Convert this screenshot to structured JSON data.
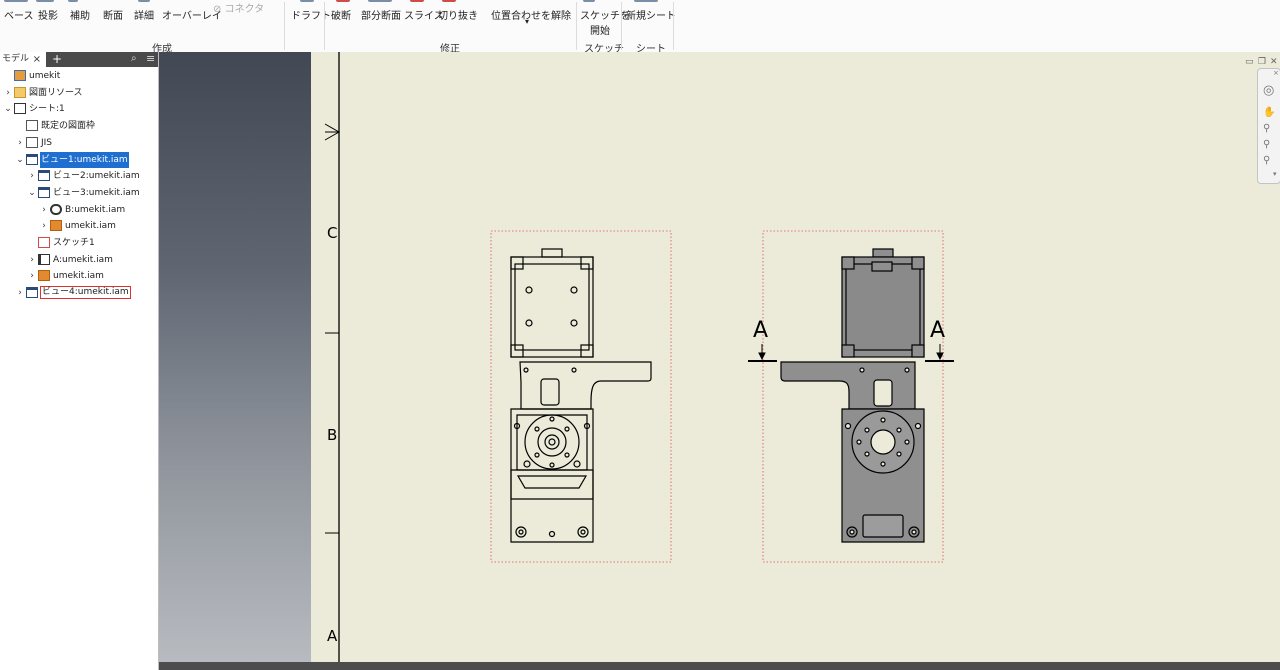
{
  "ribbon": {
    "create_group": {
      "label": "作成",
      "buttons": [
        "ベース",
        "投影",
        "補助",
        "断面",
        "詳細",
        "オーバーレイ"
      ],
      "connector": "コネクタ"
    },
    "draft": "ドラフト",
    "modify_group": {
      "label": "修正",
      "buttons": [
        "破断",
        "部分断面",
        "スライス",
        "切り抜き"
      ],
      "unalign": "位置合わせを解除"
    },
    "sketch_group": {
      "label": "スケッチ",
      "start_line1": "スケッチを",
      "start_line2": "開始"
    },
    "sheet_group": {
      "label": "シート",
      "new_sheet": "新規シート"
    }
  },
  "browser": {
    "tab_label": "モデル",
    "close": "×",
    "add": "+",
    "tree": [
      {
        "label": "umekit",
        "indent": 0,
        "chevron": "",
        "icon": "assembly-icon",
        "state": ""
      },
      {
        "label": "図面リソース",
        "indent": 0,
        "chevron": "›",
        "icon": "folder-icon",
        "state": ""
      },
      {
        "label": "シート:1",
        "indent": 0,
        "chevron": "⌄",
        "icon": "sheet-icon",
        "state": ""
      },
      {
        "label": "既定の図面枠",
        "indent": 1,
        "chevron": "",
        "icon": "border-icon",
        "state": ""
      },
      {
        "label": "JIS",
        "indent": 1,
        "chevron": "›",
        "icon": "titleblock-icon",
        "state": ""
      },
      {
        "label": "ビュー1:umekit.iam",
        "indent": 1,
        "chevron": "⌄",
        "icon": "view-icon",
        "state": "selected"
      },
      {
        "label": "ビュー2:umekit.iam",
        "indent": 2,
        "chevron": "›",
        "icon": "view-icon",
        "state": ""
      },
      {
        "label": "ビュー3:umekit.iam",
        "indent": 2,
        "chevron": "⌄",
        "icon": "view-icon",
        "state": ""
      },
      {
        "label": "B:umekit.iam",
        "indent": 3,
        "chevron": "›",
        "icon": "detail-icon",
        "state": ""
      },
      {
        "label": "umekit.iam",
        "indent": 3,
        "chevron": "›",
        "icon": "part-icon",
        "state": ""
      },
      {
        "label": "スケッチ1",
        "indent": 2,
        "chevron": "",
        "icon": "sketch-icon",
        "state": ""
      },
      {
        "label": "A:umekit.iam",
        "indent": 2,
        "chevron": "›",
        "icon": "section-icon",
        "state": ""
      },
      {
        "label": "umekit.iam",
        "indent": 2,
        "chevron": "›",
        "icon": "part-icon",
        "state": ""
      },
      {
        "label": "ビュー4:umekit.iam",
        "indent": 1,
        "chevron": "›",
        "icon": "view-icon",
        "state": "outlined"
      }
    ]
  },
  "drawing": {
    "zone_labels": [
      "C",
      "B",
      "A"
    ],
    "section_label": "A"
  },
  "colors": {
    "sheet": "#ecebd9",
    "selection": "#1f6fd1",
    "part_fill": "#8f8f8f"
  }
}
